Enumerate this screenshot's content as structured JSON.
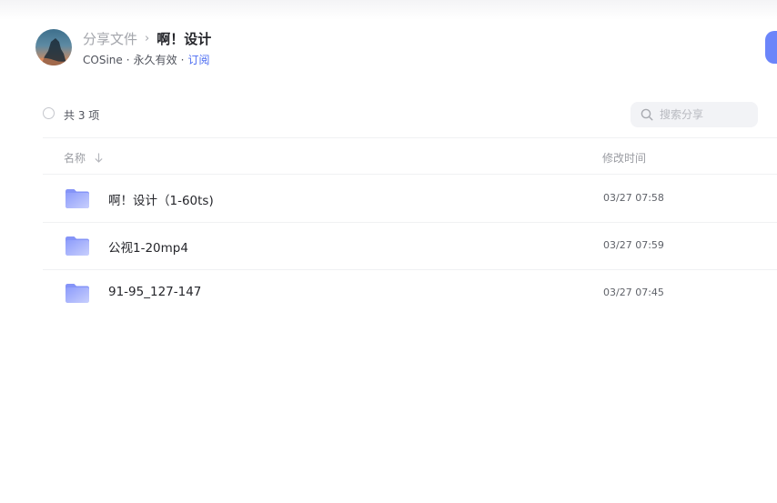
{
  "header": {
    "breadcrumb_parent": "分享文件",
    "breadcrumb_separator": "›",
    "breadcrumb_current": "啊！设计",
    "owner_name": "COSine",
    "separator_dot": "·",
    "validity": "永久有效",
    "subscribe_label": "订阅"
  },
  "toolbar": {
    "item_count": "共 3 项",
    "search_placeholder": "搜索分享"
  },
  "table": {
    "columns": {
      "name": "名称",
      "modified_time": "修改时间"
    },
    "rows": [
      {
        "name": "啊！设计（1-60ts)",
        "time": "03/27 07:58",
        "icon": "folder-icon"
      },
      {
        "name": "公视1-20mp4",
        "time": "03/27 07:59",
        "icon": "folder-icon"
      },
      {
        "name": "91-95_127-147",
        "time": "03/27 07:45",
        "icon": "folder-icon"
      }
    ]
  },
  "colors": {
    "accent": "#4e6ef2",
    "folder": "#8d9cfb",
    "primary_button": "#6b85fa"
  }
}
